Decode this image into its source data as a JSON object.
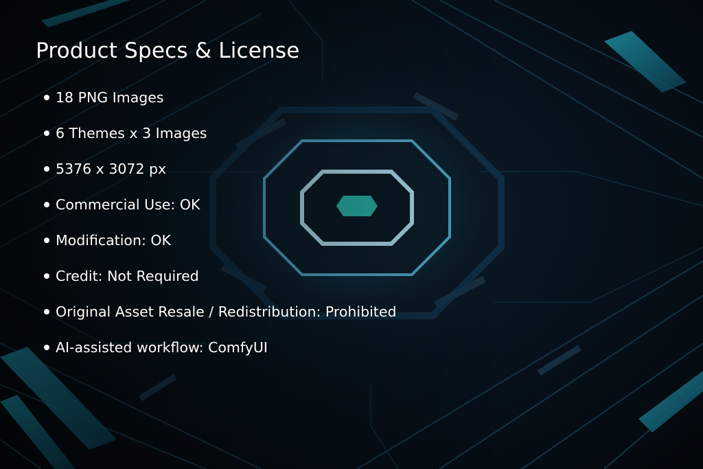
{
  "title": "Product Specs & License",
  "specs": [
    "18 PNG Images",
    "6 Themes x 3 Images",
    "5376 x 3072 px",
    "Commercial Use: OK",
    "Modification: OK",
    "Credit: Not Required",
    "Original Asset Resale / Redistribution: Prohibited",
    "AI-assisted workflow: ComfyUI"
  ],
  "colors": {
    "text": "#ffffff",
    "background": "#05090f",
    "accent_teal": "#2fd3c4",
    "circuit_blue": "#1c6f99"
  }
}
